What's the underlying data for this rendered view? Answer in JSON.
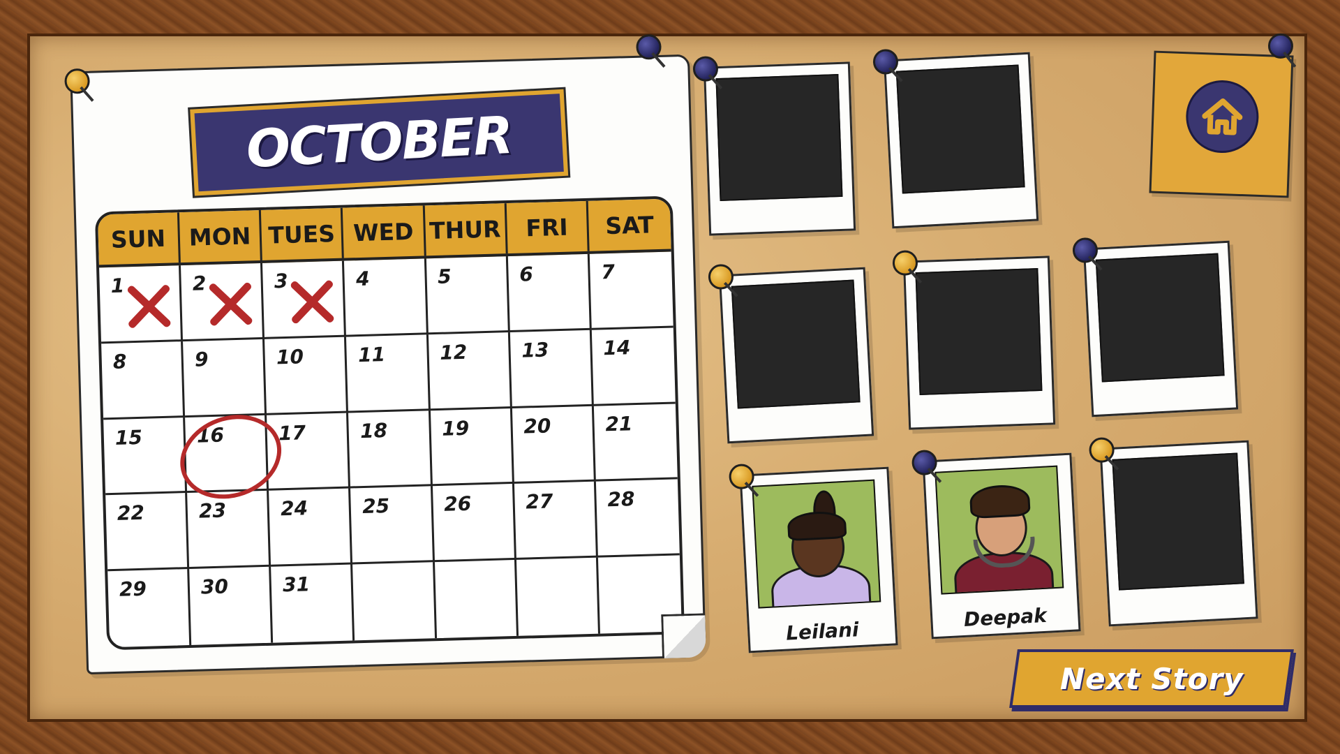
{
  "calendar": {
    "month": "OCTOBER",
    "days_of_week": [
      "SUN",
      "MON",
      "TUES",
      "WED",
      "THUR",
      "FRI",
      "SAT"
    ],
    "weeks": [
      [
        "1",
        "2",
        "3",
        "4",
        "5",
        "6",
        "7"
      ],
      [
        "8",
        "9",
        "10",
        "11",
        "12",
        "13",
        "14"
      ],
      [
        "15",
        "16",
        "17",
        "18",
        "19",
        "20",
        "21"
      ],
      [
        "22",
        "23",
        "24",
        "25",
        "26",
        "27",
        "28"
      ],
      [
        "29",
        "30",
        "31",
        "",
        "",
        "",
        ""
      ]
    ],
    "crossed_out_days": [
      "1",
      "2",
      "3"
    ],
    "circled_day": "16",
    "mark_color": "#b52a2a",
    "header_color": "#e0a530",
    "banner_color": "#3a3670"
  },
  "photos": [
    {
      "row": 1,
      "label": "",
      "revealed": false,
      "pin": "navy"
    },
    {
      "row": 1,
      "label": "",
      "revealed": false,
      "pin": "navy"
    },
    {
      "row": 2,
      "label": "",
      "revealed": false,
      "pin": "gold"
    },
    {
      "row": 2,
      "label": "",
      "revealed": false,
      "pin": "gold"
    },
    {
      "row": 2,
      "label": "",
      "revealed": false,
      "pin": "navy"
    },
    {
      "row": 3,
      "label": "Leilani",
      "revealed": true,
      "pin": "gold"
    },
    {
      "row": 3,
      "label": "Deepak",
      "revealed": true,
      "pin": "navy"
    },
    {
      "row": 3,
      "label": "",
      "revealed": false,
      "pin": "gold"
    }
  ],
  "nav": {
    "home_icon": "home-icon",
    "next_story_label": "Next Story"
  }
}
